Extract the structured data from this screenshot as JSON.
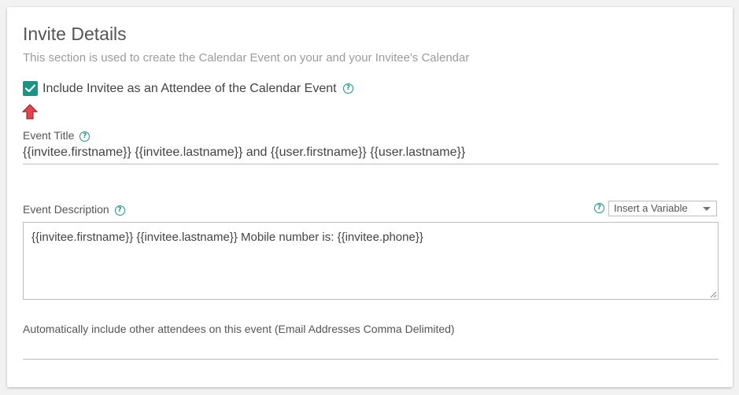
{
  "section": {
    "title": "Invite Details",
    "subtitle": "This section is used to create the Calendar Event on your and your Invitee's Calendar"
  },
  "include_invitee": {
    "label": "Include Invitee as an Attendee of the Calendar Event",
    "checked": true
  },
  "event_title": {
    "label": "Event Title",
    "value": "{{invitee.firstname}} {{invitee.lastname}} and {{user.firstname}} {{user.lastname}}"
  },
  "event_description": {
    "label": "Event Description",
    "value": "{{invitee.firstname}} {{invitee.lastname}} Mobile number is: {{invitee.phone}}",
    "insert_variable": "Insert a Variable"
  },
  "other_attendees": {
    "label": "Automatically include other attendees on this event (Email Addresses Comma Delimited)",
    "value": ""
  },
  "colors": {
    "accent": "#1a9484",
    "arrow": "#e8434a"
  },
  "icons": [
    "check-icon",
    "help-icon",
    "red-arrow-up-icon",
    "chevron-down-icon",
    "resize-grip-icon"
  ]
}
